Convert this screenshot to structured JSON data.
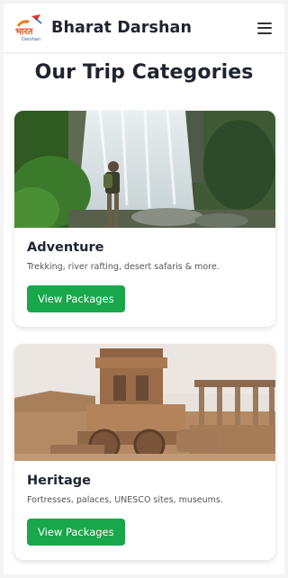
{
  "header": {
    "brand": "Bharat Darshan",
    "logo_text": "भारत",
    "logo_sub": "Darshan"
  },
  "section_title": "Our Trip Categories",
  "categories": [
    {
      "title": "Adventure",
      "description": "Trekking, river rafting, desert safaris & more.",
      "button_label": "View Packages",
      "image": "waterfall-hiker-image"
    },
    {
      "title": "Heritage",
      "description": "Fortresses, palaces, UNESCO sites, museums.",
      "button_label": "View Packages",
      "image": "stone-chariot-image"
    }
  ],
  "colors": {
    "accent_button": "#18a74a",
    "heading": "#1f2430",
    "logo": "#e8501e"
  }
}
